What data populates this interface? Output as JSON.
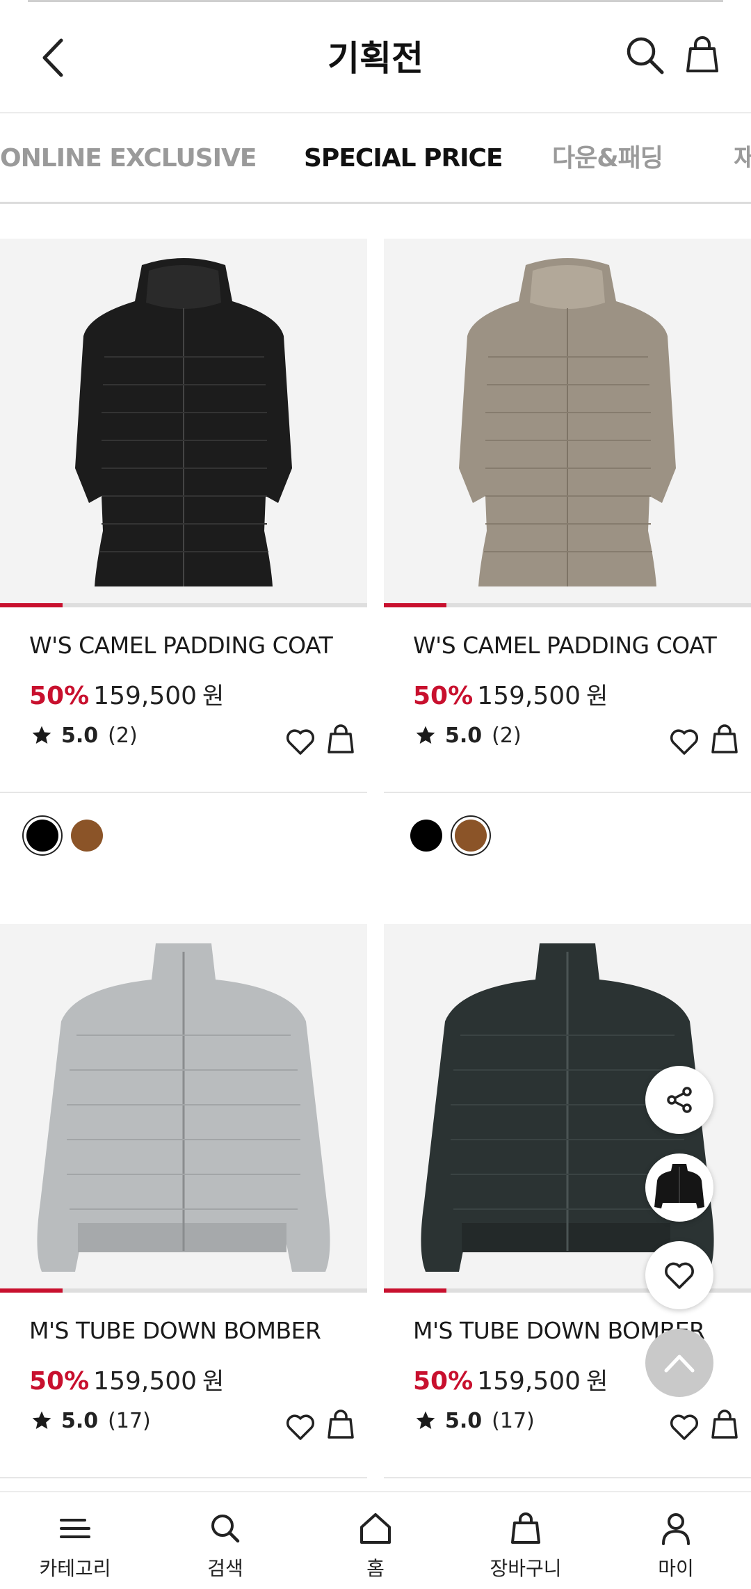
{
  "header": {
    "title": "기획전",
    "back_icon": "chevron-left-icon",
    "search_icon": "search-icon",
    "bag_icon": "shopping-bag-icon"
  },
  "tabs": [
    {
      "label": "ONLINE EXCLUSIVE",
      "active": false
    },
    {
      "label": "SPECIAL PRICE",
      "active": true
    },
    {
      "label": "다운&패딩",
      "active": false
    },
    {
      "label": "재",
      "active": false
    }
  ],
  "colors": {
    "accent": "#c8102e",
    "text": "#222222",
    "swatch_black": "#000000",
    "swatch_brown": "#8b5428"
  },
  "products": [
    {
      "name": "W'S CAMEL PADDING COAT",
      "discount": "50%",
      "price": "159,500",
      "currency": "원",
      "rating": "5.0",
      "reviews": "(2)",
      "image_progress": 0.17,
      "image": "black padded hooded coat",
      "swatches": [
        {
          "color": "#000000",
          "selected": true
        },
        {
          "color": "#8b5428",
          "selected": false
        }
      ]
    },
    {
      "name": "W'S CAMEL PADDING COAT",
      "discount": "50%",
      "price": "159,500",
      "currency": "원",
      "rating": "5.0",
      "reviews": "(2)",
      "image_progress": 0.17,
      "image": "beige padded hooded coat",
      "swatches": [
        {
          "color": "#000000",
          "selected": false
        },
        {
          "color": "#8b5428",
          "selected": true
        }
      ]
    },
    {
      "name": "M'S TUBE DOWN BOMBER",
      "discount": "50%",
      "price": "159,500",
      "currency": "원",
      "rating": "5.0",
      "reviews": "(17)",
      "image_progress": 0.17,
      "image": "light grey down bomber jacket"
    },
    {
      "name": "M'S TUBE DOWN BOMBER",
      "discount": "50%",
      "price": "159,500",
      "currency": "원",
      "rating": "5.0",
      "reviews": "(17)",
      "image_progress": 0.17,
      "image": "dark green down bomber jacket"
    }
  ],
  "floating": {
    "share_icon": "share-icon",
    "thumbnail": "black puffer jacket",
    "wishlist_icon": "heart-icon",
    "scroll_top_icon": "chevron-up-icon"
  },
  "bottom_nav": [
    {
      "label": "카테고리",
      "icon": "menu-icon"
    },
    {
      "label": "검색",
      "icon": "search-icon"
    },
    {
      "label": "홈",
      "icon": "home-icon"
    },
    {
      "label": "장바구니",
      "icon": "shopping-bag-icon"
    },
    {
      "label": "마이",
      "icon": "user-icon"
    }
  ]
}
